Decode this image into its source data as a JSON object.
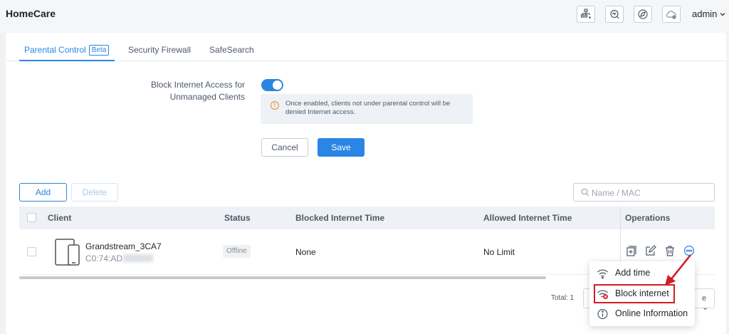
{
  "header": {
    "app_title": "HomeCare",
    "icons": [
      "network-add-icon",
      "search-scan-icon",
      "compass-icon",
      "cloud-icon"
    ],
    "user": "admin"
  },
  "tabs": [
    {
      "label": "Parental Control",
      "badge": "Beta",
      "active": true
    },
    {
      "label": "Security Firewall",
      "active": false
    },
    {
      "label": "SafeSearch",
      "active": false
    }
  ],
  "form": {
    "block_label_line1": "Block Internet Access for",
    "block_label_line2": "Unmanaged Clients",
    "toggle_on": true,
    "notice": "Once enabled, clients not under parental control will be denied Internet access.",
    "notice_icon": "info-circle-icon",
    "cancel": "Cancel",
    "save": "Save"
  },
  "toolbar": {
    "add": "Add",
    "delete": "Delete",
    "search_placeholder": "Name / MAC"
  },
  "table": {
    "columns": [
      "Client",
      "Status",
      "Blocked Internet Time",
      "Allowed Internet Time",
      "Operations"
    ],
    "rows": [
      {
        "name": "Grandstream_3CA7",
        "mac": "C0:74:AD",
        "status": "Offline",
        "blocked": "None",
        "allowed": "No Limit"
      }
    ]
  },
  "footer": {
    "total": "Total: 1",
    "pager_fragment": "e"
  },
  "menu": {
    "items": [
      {
        "label": "Add time",
        "icon": "wifi-icon"
      },
      {
        "label": "Block internet",
        "icon": "wifi-block-icon"
      },
      {
        "label": "Online Information",
        "icon": "info-icon"
      }
    ]
  },
  "colors": {
    "accent": "#2b85e4",
    "annotation": "#d11e23",
    "warning": "#f08a24"
  }
}
